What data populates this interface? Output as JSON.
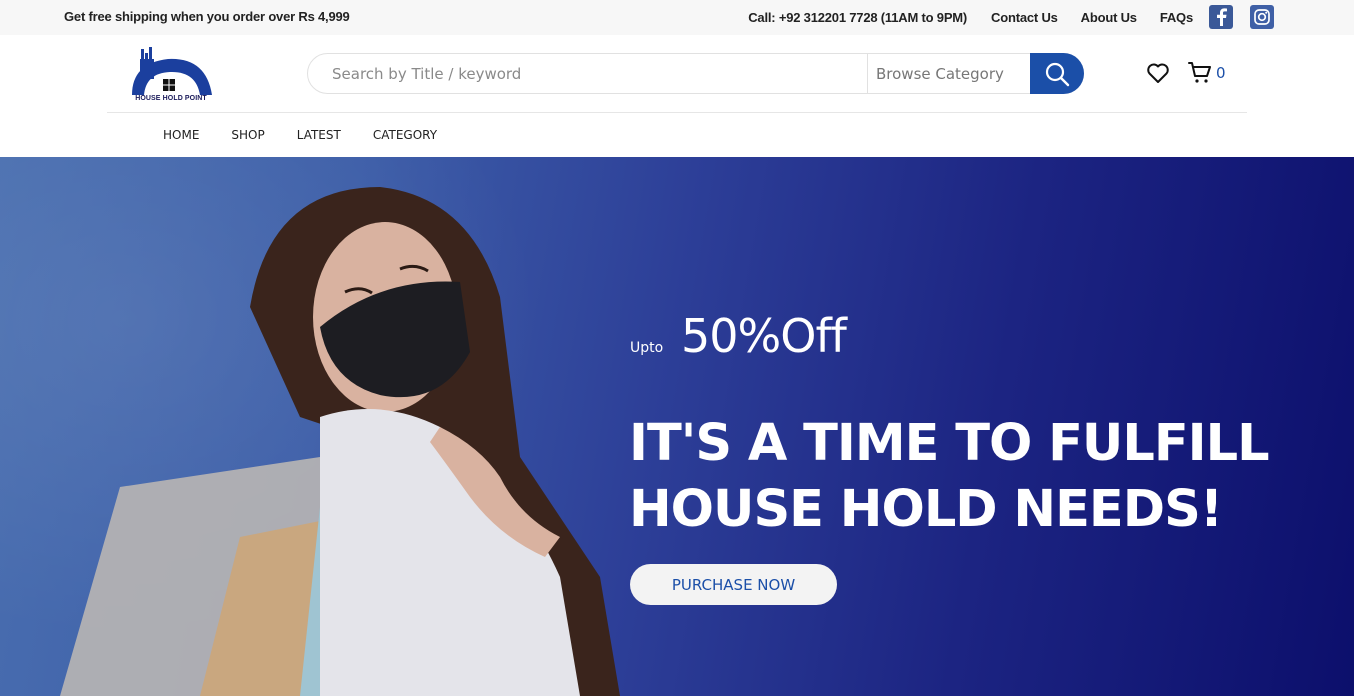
{
  "topbar": {
    "promo": "Get free shipping when you order over Rs 4,999",
    "call": "Call: +92 312201 7728 (11AM to 9PM)",
    "links": [
      "Contact Us",
      "About Us",
      "FAQs"
    ],
    "social": [
      "facebook-icon",
      "instagram-icon"
    ]
  },
  "header": {
    "logo_text": "HOUSE HOLD POINT",
    "search": {
      "placeholder": "Search by Title / keyword",
      "category_label": "Browse Category"
    },
    "cart_count": "0",
    "brand_color": "#1b4fa8"
  },
  "nav": {
    "items": [
      "HOME",
      "SHOP",
      "LATEST",
      "CATEGORY"
    ]
  },
  "hero": {
    "upto": "Upto",
    "discount": "50%Off",
    "headline_line1": "IT'S A TIME TO FULFILL",
    "headline_line2": "HOUSE HOLD NEEDS!",
    "cta": "PURCHASE NOW",
    "bg_start": "#4a6fb0",
    "bg_end": "#0c0f6c"
  }
}
